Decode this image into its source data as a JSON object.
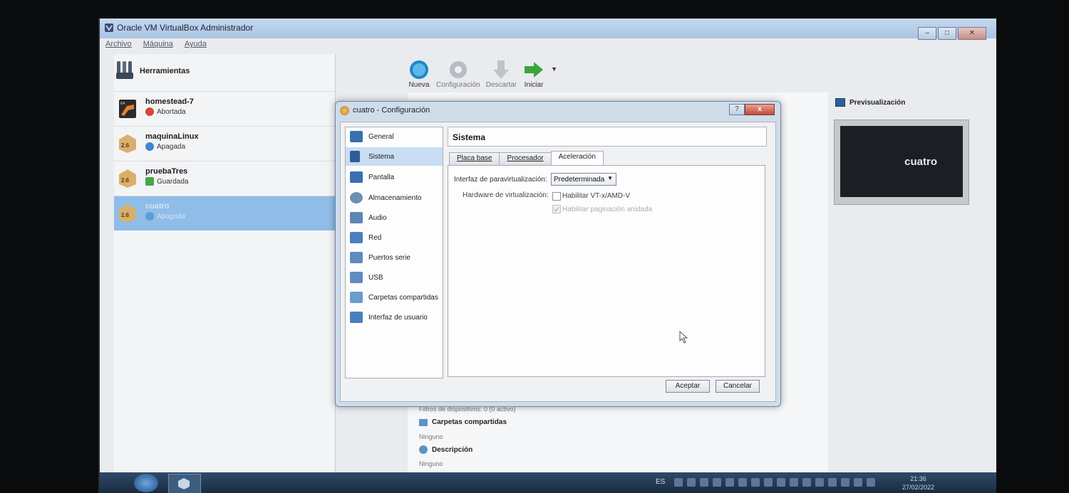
{
  "window": {
    "title": "Oracle VM VirtualBox Administrador"
  },
  "menu": [
    "Archivo",
    "Máquina",
    "Ayuda"
  ],
  "tools": {
    "label": "Herramientas"
  },
  "vms": [
    {
      "name": "homestead-7",
      "state": "Abortada",
      "badge": ""
    },
    {
      "name": "maquinaLinux",
      "state": "Apagada",
      "badge": "2.6"
    },
    {
      "name": "pruebaTres",
      "state": "Guardada",
      "badge": "2.6"
    },
    {
      "name": "cuatro",
      "state": "Apagada",
      "badge": "2.6"
    }
  ],
  "toolbar": {
    "new": "Nueva",
    "settings": "Configuración",
    "discard": "Descartar",
    "start": "Iniciar"
  },
  "preview": {
    "title": "Previsualización",
    "vm": "cuatro"
  },
  "details_bottom": {
    "filters": "Filtros de dispositivos:   0 (0 activo)",
    "shared_title": "Carpetas compartidas",
    "shared_value": "Ninguno",
    "desc_title": "Descripción",
    "desc_value": "Ninguno"
  },
  "dialog": {
    "title": "cuatro - Configuración",
    "help": "?",
    "close": "x",
    "categories": [
      "General",
      "Sistema",
      "Pantalla",
      "Almacenamiento",
      "Audio",
      "Red",
      "Puertos serie",
      "USB",
      "Carpetas compartidas",
      "Interfaz de usuario"
    ],
    "page_title": "Sistema",
    "tabs": [
      "Placa base",
      "Procesador",
      "Aceleración"
    ],
    "paravirt_label": "Interfaz de paravirtualización:",
    "paravirt_value": "Predeterminada",
    "hw_label": "Hardware de virtualización:",
    "vtx_label": "Habilitar VT-x/AMD-V",
    "nested_label": "Habilitar paginación anidada",
    "ok": "Aceptar",
    "cancel": "Cancelar"
  },
  "taskbar": {
    "lang": "ES",
    "time": "21:36",
    "date": "27/02/2022"
  },
  "colors": {
    "selection": "#8fbde8",
    "accent": "#1e88c8"
  }
}
